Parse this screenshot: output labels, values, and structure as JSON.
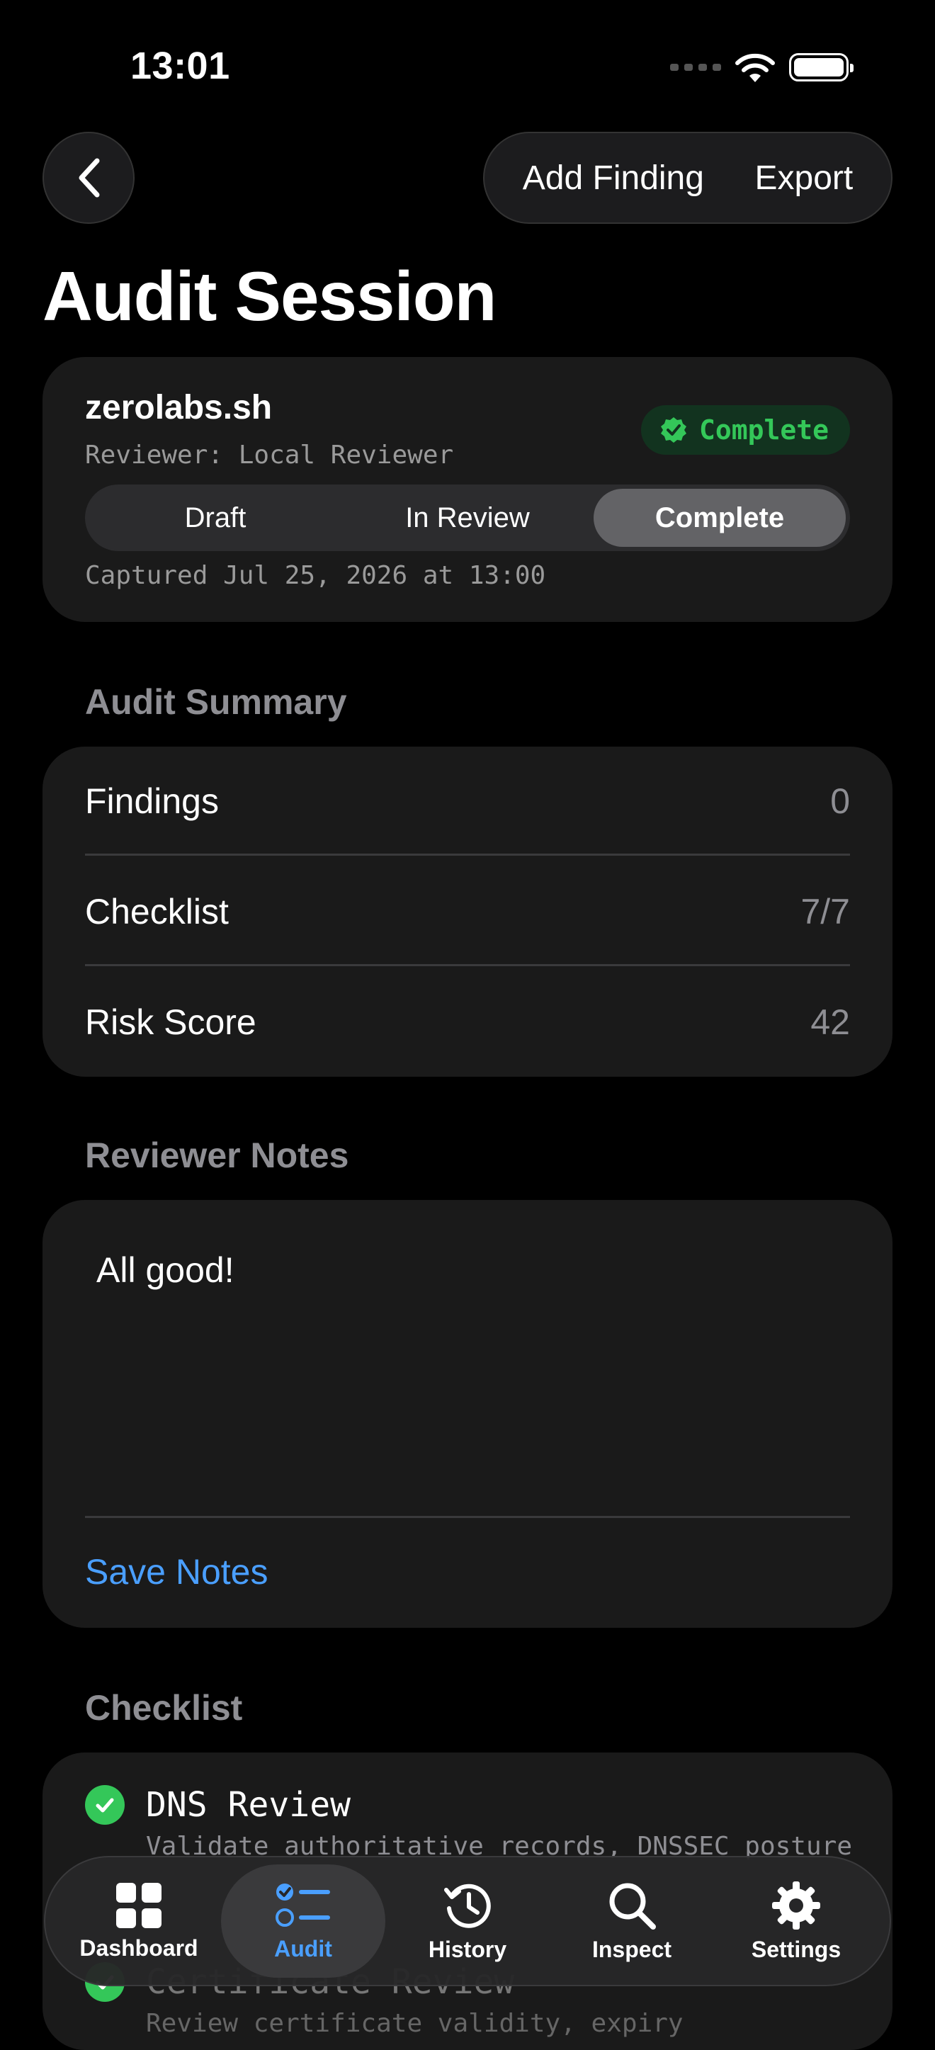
{
  "status_bar": {
    "time": "13:01"
  },
  "nav": {
    "add_finding_label": "Add Finding",
    "export_label": "Export"
  },
  "page_title": "Audit Session",
  "session": {
    "domain": "zerolabs.sh",
    "reviewer": "Reviewer: Local Reviewer",
    "status_badge": "Complete",
    "status_options": [
      "Draft",
      "In Review",
      "Complete"
    ],
    "selected_status": "Complete",
    "captured": "Captured Jul 25, 2026 at 13:00"
  },
  "summary": {
    "header": "Audit Summary",
    "rows": [
      {
        "label": "Findings",
        "value": "0"
      },
      {
        "label": "Checklist",
        "value": "7/7"
      },
      {
        "label": "Risk Score",
        "value": "42"
      }
    ]
  },
  "notes": {
    "header": "Reviewer Notes",
    "text": "All good!",
    "save_label": "Save Notes"
  },
  "checklist": {
    "header": "Checklist",
    "items": [
      {
        "title": "DNS Review",
        "description": "Validate authoritative records, DNSSEC posture"
      },
      {
        "title": "Certificate Review",
        "description": "Review certificate validity, expiry"
      }
    ]
  },
  "tabs": [
    {
      "label": "Dashboard",
      "icon": "grid-icon"
    },
    {
      "label": "Audit",
      "icon": "checklist-icon"
    },
    {
      "label": "History",
      "icon": "clock-history-icon"
    },
    {
      "label": "Inspect",
      "icon": "magnifier-icon"
    },
    {
      "label": "Settings",
      "icon": "gear-icon"
    }
  ],
  "active_tab": "Audit",
  "colors": {
    "accent": "#4a9fff",
    "success": "#34c759",
    "background": "#000000",
    "card": "#1a1a1a"
  }
}
